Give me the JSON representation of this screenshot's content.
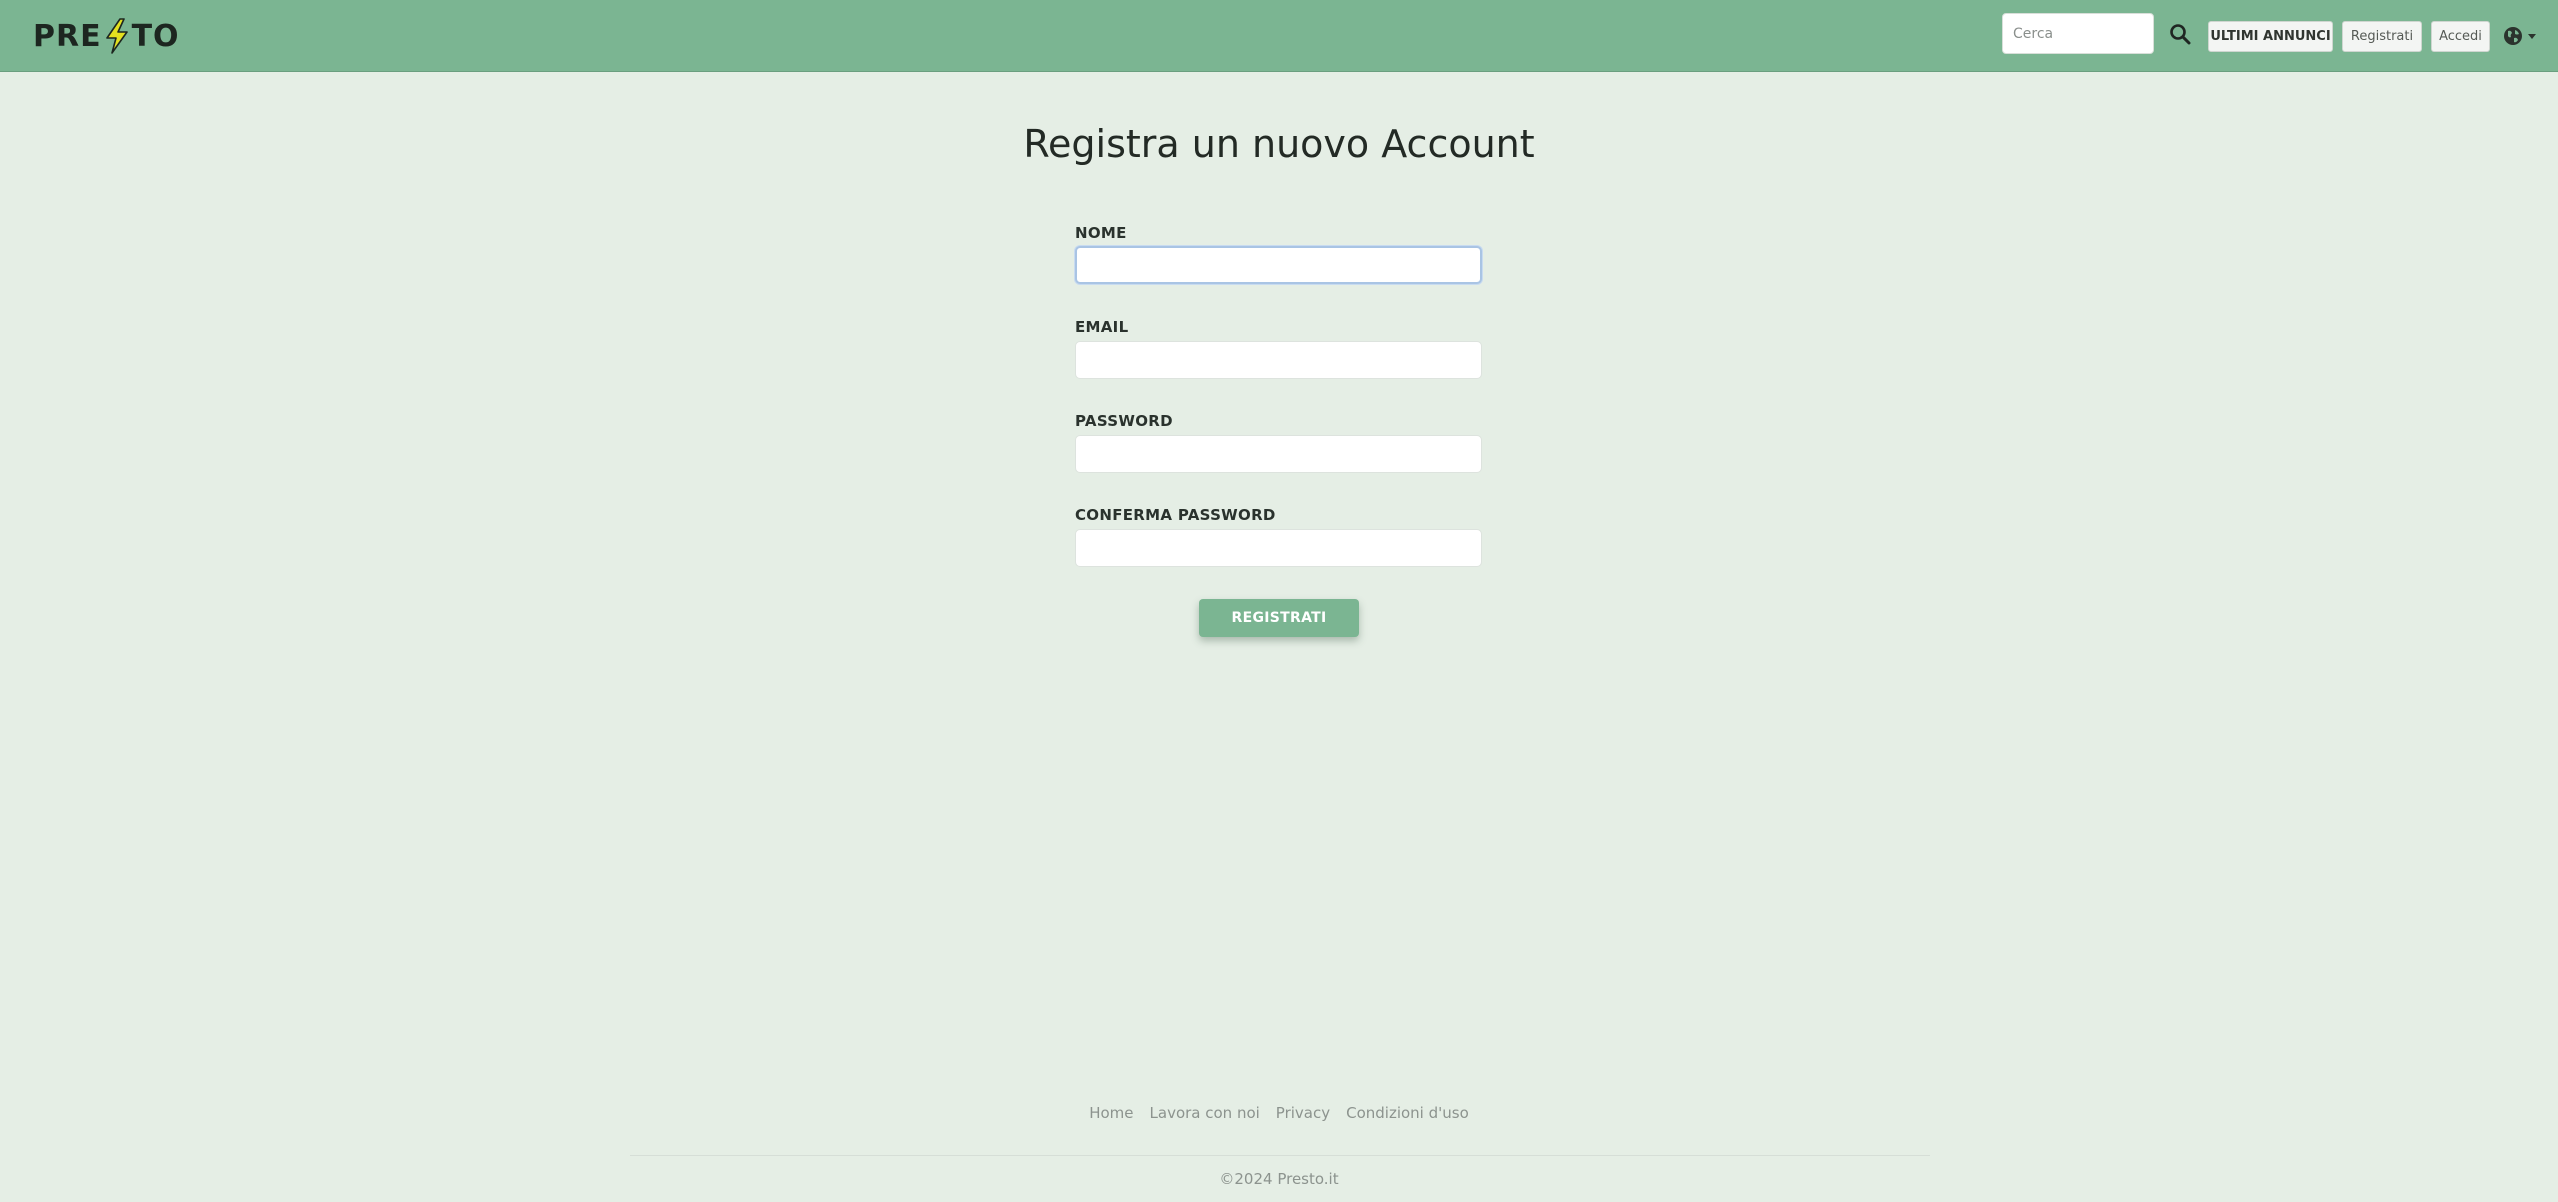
{
  "brand": {
    "logo_prefix": "PRE",
    "logo_suffix": "TO",
    "logo_icon": "lightning-bolt-icon",
    "colors": {
      "navbar": "#7bb592",
      "background": "#e5eee5",
      "bolt": "#e3e020",
      "accent": "#7bb592"
    }
  },
  "navbar": {
    "search_placeholder": "Cerca",
    "search_icon": "search-icon",
    "ultimi_annunci_label": "ULTIMI ANNUNCI",
    "registrati_label": "Registrati",
    "accedi_label": "Accedi",
    "language_icon": "globe-icon"
  },
  "form": {
    "title": "Registra un nuovo Account",
    "fields": [
      {
        "label": "NOME",
        "value": ""
      },
      {
        "label": "EMAIL",
        "value": ""
      },
      {
        "label": "PASSWORD",
        "value": ""
      },
      {
        "label": "CONFERMA PASSWORD",
        "value": ""
      }
    ],
    "submit_label": "REGISTRATI"
  },
  "footer": {
    "links": [
      "Home",
      "Lavora con noi",
      "Privacy",
      "Condizioni d'uso"
    ],
    "copyright": "©2024 Presto.it"
  }
}
